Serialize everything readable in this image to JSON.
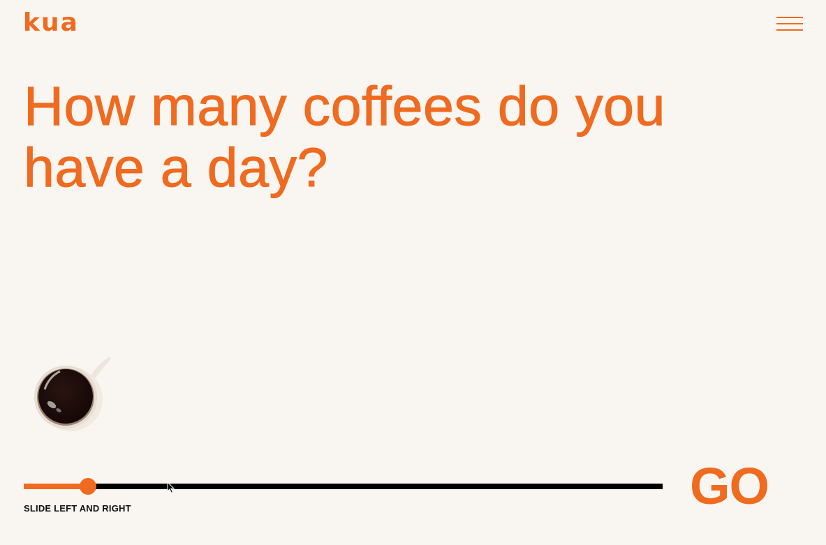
{
  "header": {
    "logo": "kua",
    "menu_icon": "hamburger-menu-icon"
  },
  "main": {
    "question": "How many coffees do you have a day?"
  },
  "slider": {
    "value_fraction": 0.1,
    "hint": "SLIDE LEFT AND RIGHT"
  },
  "actions": {
    "go_label": "GO"
  },
  "colors": {
    "accent": "#f06a1f",
    "background": "#f9f6f1",
    "track": "#000000"
  },
  "illustration": {
    "icon": "coffee-cup-icon"
  }
}
